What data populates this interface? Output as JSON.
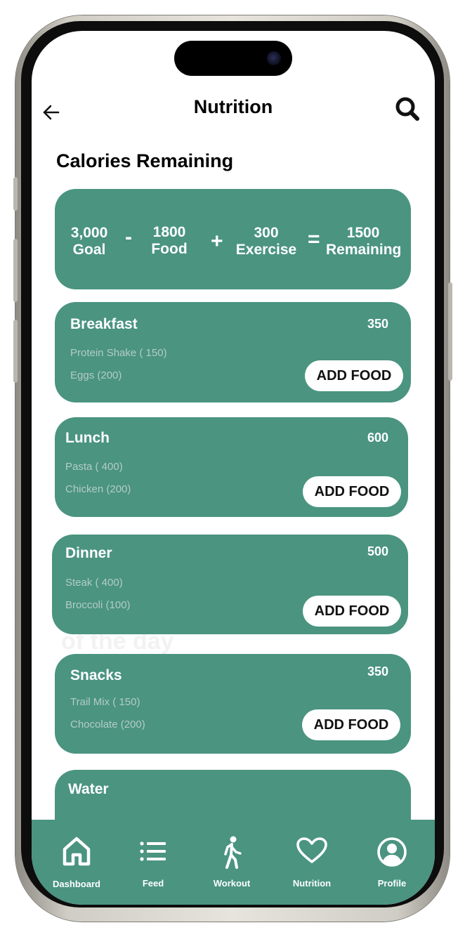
{
  "header": {
    "title": "Nutrition",
    "back_icon": "arrow-left-icon",
    "search_icon": "search-icon"
  },
  "section_title": "Calories Remaining",
  "summary": {
    "goal_value": "3,000",
    "goal_label": "Goal",
    "minus": "-",
    "food_value": "1800",
    "food_label": "Food",
    "plus": "+",
    "exercise_value": "300",
    "exercise_label": "Exercise",
    "equals": "=",
    "remaining_value": "1500",
    "remaining_label": "Remaining"
  },
  "meals": [
    {
      "name": "Breakfast",
      "calories": "350",
      "items": [
        "Protein Shake ( 150)",
        "Eggs (200)"
      ],
      "button": "ADD FOOD"
    },
    {
      "name": "Lunch",
      "calories": "600",
      "items": [
        "Pasta ( 400)",
        "Chicken (200)"
      ],
      "button": "ADD FOOD"
    },
    {
      "name": "Dinner",
      "calories": "500",
      "items": [
        "Steak ( 400)",
        "Broccoli (100)"
      ],
      "button": "ADD FOOD"
    },
    {
      "name": "Snacks",
      "calories": "350",
      "items": [
        "Trail Mix ( 150)",
        "Chocolate (200)"
      ],
      "button": "ADD FOOD"
    }
  ],
  "water": {
    "name": "Water"
  },
  "ghost_text": "of the day",
  "nav": [
    {
      "label": "Dashboard",
      "icon": "home-icon"
    },
    {
      "label": "Feed",
      "icon": "list-icon"
    },
    {
      "label": "Workout",
      "icon": "walking-person-icon"
    },
    {
      "label": "Nutrition",
      "icon": "heart-icon"
    },
    {
      "label": "Profile",
      "icon": "user-circle-icon"
    }
  ],
  "colors": {
    "accent": "#4a9480",
    "item_text": "#b5ccc4",
    "button_bg": "#ffffff"
  }
}
